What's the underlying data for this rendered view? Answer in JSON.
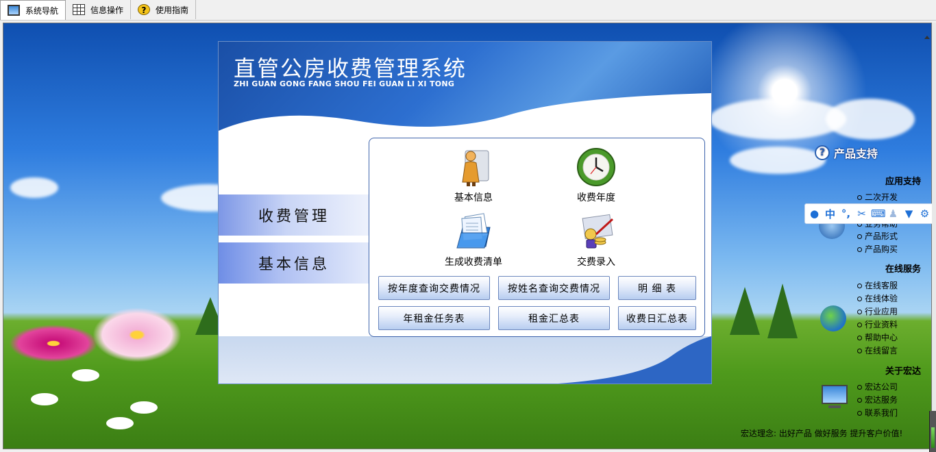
{
  "tabs": [
    {
      "label": "系统导航",
      "icon": "monitor-icon",
      "active": true
    },
    {
      "label": "信息操作",
      "icon": "grid-icon",
      "active": false
    },
    {
      "label": "使用指南",
      "icon": "help-icon",
      "active": false
    }
  ],
  "panel": {
    "title": "直管公房收费管理系统",
    "subtitle": "ZHI GUAN GONG FANG SHOU FEI GUAN LI XI TONG"
  },
  "side_menu": {
    "items": [
      {
        "label": "收费管理"
      },
      {
        "label": "基本信息"
      }
    ]
  },
  "icon_items": [
    {
      "label": "基本信息",
      "icon": "person-icon"
    },
    {
      "label": "收费年度",
      "icon": "clock-icon"
    },
    {
      "label": "生成收费清单",
      "icon": "folder-docs-icon"
    },
    {
      "label": "交费录入",
      "icon": "payment-icon"
    }
  ],
  "buttons": [
    {
      "label": "按年度查询交费情况"
    },
    {
      "label": "按姓名查询交费情况"
    },
    {
      "label": "明 细 表"
    },
    {
      "label": "年租金任务表"
    },
    {
      "label": "租金汇总表"
    },
    {
      "label": "收费日汇总表"
    }
  ],
  "support": {
    "title": "产品支持",
    "sections": [
      {
        "title": "应用支持",
        "links": [
          "二次开发",
          "业务帮助",
          "产品形式",
          "产品购买"
        ]
      },
      {
        "title": "在线服务",
        "links": [
          "在线客服",
          "在线体验",
          "行业应用",
          "行业资料",
          "帮助中心",
          "在线留言"
        ]
      },
      {
        "title": "关于宏达",
        "links": [
          "宏达公司",
          "宏达服务",
          "联系我们"
        ]
      }
    ]
  },
  "ime_toolbar": {
    "mode_label": "中",
    "items": [
      "user-icon",
      "chinese-mode",
      "punctuation-icon",
      "scissors-icon",
      "keyboard-icon",
      "person-icon",
      "shirt-icon",
      "gear-icon"
    ]
  },
  "slogan": "宏达理念: 出好产品  做好服务  提升客户价值!",
  "colors": {
    "panel_header": "#2d6fd0",
    "button_border": "#6a86bd",
    "side_item": "#7d97e6",
    "ime_blue": "#1d6fd6"
  }
}
